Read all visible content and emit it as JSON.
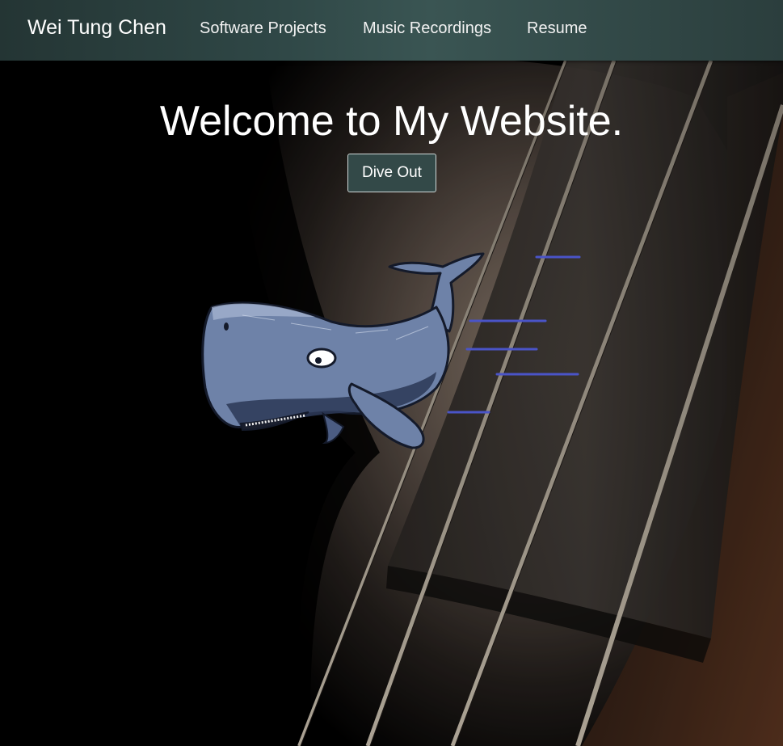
{
  "navbar": {
    "brand": "Wei Tung Chen",
    "links": [
      {
        "label": "Software Projects"
      },
      {
        "label": "Music Recordings"
      },
      {
        "label": "Resume"
      }
    ]
  },
  "hero": {
    "title": "Welcome to My Website.",
    "button_label": "Dive Out"
  },
  "images": {
    "background": "cello-strings-background",
    "mascot": "cartoon-whale"
  },
  "colors": {
    "navbar": "#2f4746",
    "button": "#334948",
    "whale_body": "#6e82a8",
    "speed_lines": "#4a54c8"
  }
}
